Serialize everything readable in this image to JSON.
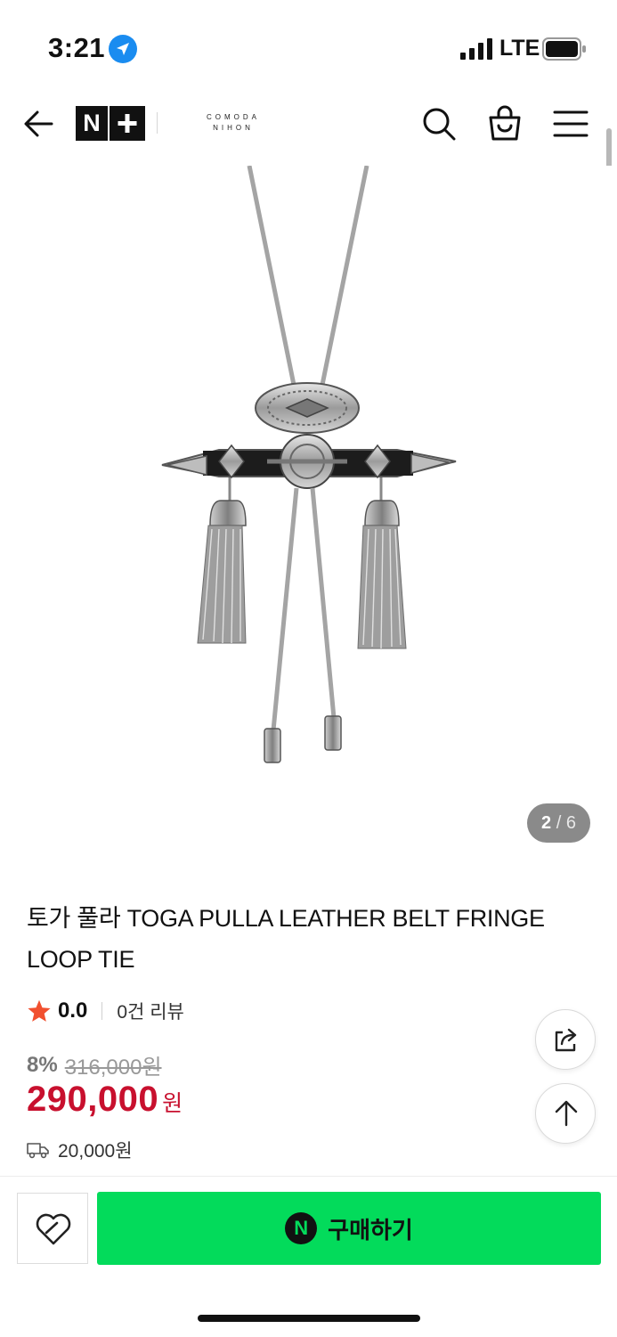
{
  "status_bar": {
    "time": "3:21",
    "network": "LTE"
  },
  "header": {
    "logo_n": "N",
    "brand_line1": "COMODA",
    "brand_line2": "NIHON"
  },
  "gallery": {
    "current": "2",
    "separator": "/",
    "total": "6"
  },
  "product": {
    "title": "토가 풀라 TOGA PULLA LEATHER BELT FRINGE LOOP TIE",
    "rating": "0.0",
    "review_count": "0건 리뷰",
    "discount_rate": "8%",
    "original_price": "316,000원",
    "sale_price": "290,000",
    "sale_unit": "원",
    "shipping_fee": "20,000원"
  },
  "actions": {
    "buy_label": "구매하기",
    "naver_n": "N"
  },
  "colors": {
    "accent_green": "#03db5b",
    "price_red": "#c8102e",
    "star": "#f1502f"
  }
}
